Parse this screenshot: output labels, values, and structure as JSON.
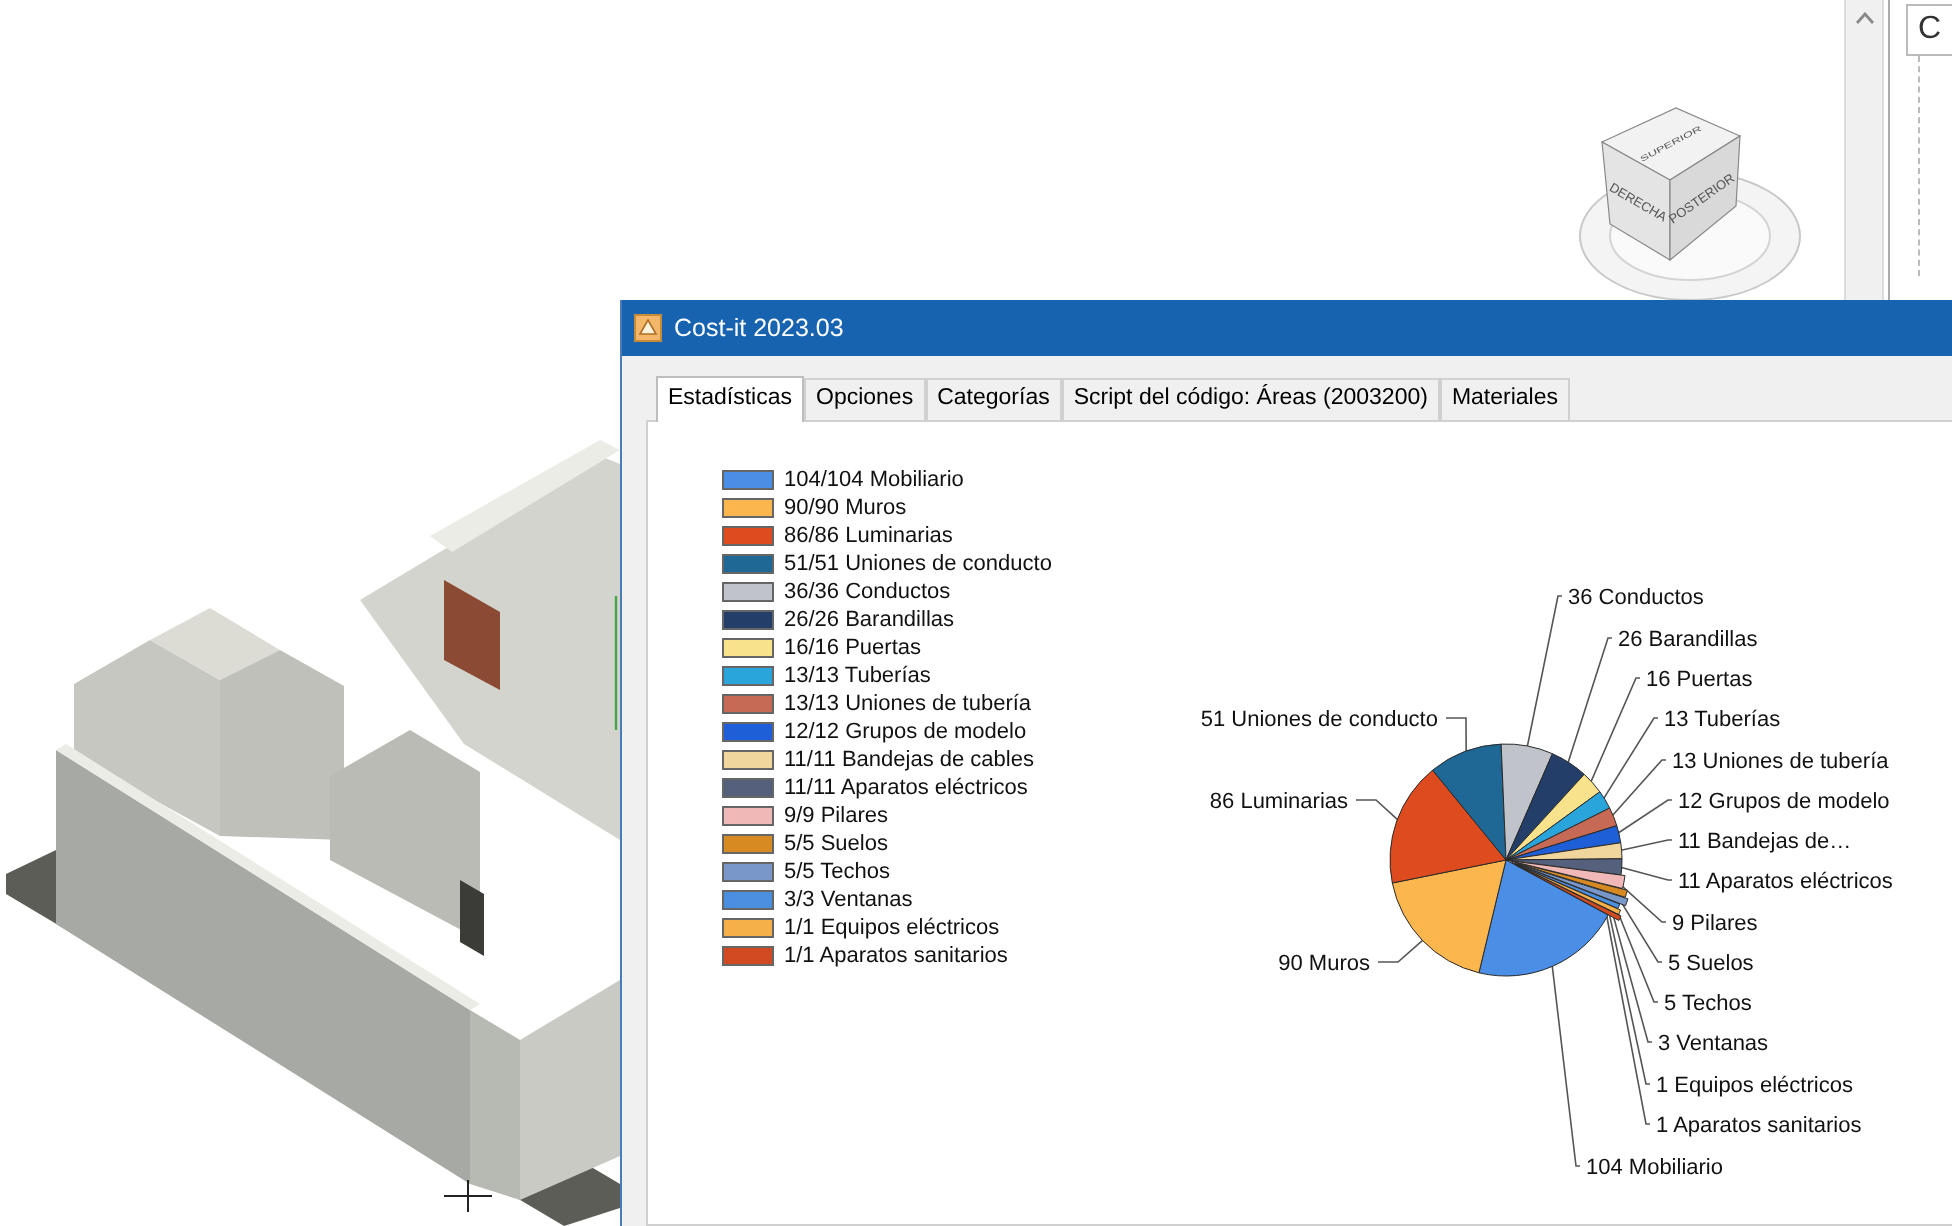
{
  "view_cube": {
    "faces": [
      "SUPERIOR",
      "DERECHA",
      "POSTERIOR"
    ]
  },
  "side_panel": {
    "field_text": "C"
  },
  "dialog": {
    "title": "Cost-it 2023.03",
    "tabs": [
      {
        "label": "Estadísticas",
        "selected": true
      },
      {
        "label": "Opciones",
        "selected": false
      },
      {
        "label": "Categorías",
        "selected": false
      },
      {
        "label": "Script del código: Áreas (2003200)",
        "selected": false
      },
      {
        "label": "Materiales",
        "selected": false
      }
    ],
    "legend": [
      {
        "label": "104/104 Mobiliario",
        "color": "#4a8ee6"
      },
      {
        "label": "90/90 Muros",
        "color": "#fbb64e"
      },
      {
        "label": "86/86 Luminarias",
        "color": "#de4b1e"
      },
      {
        "label": "51/51 Uniones de conducto",
        "color": "#1f6794"
      },
      {
        "label": "36/36 Conductos",
        "color": "#c0c3ca"
      },
      {
        "label": "26/26 Barandillas",
        "color": "#243e6a"
      },
      {
        "label": "16/16 Puertas",
        "color": "#f8e28c"
      },
      {
        "label": "13/13 Tuberías",
        "color": "#2aa5dc"
      },
      {
        "label": "13/13 Uniones de tubería",
        "color": "#c66a56"
      },
      {
        "label": "12/12 Grupos de modelo",
        "color": "#1e5ed6"
      },
      {
        "label": "11/11 Bandejas de cables",
        "color": "#f0d59c"
      },
      {
        "label": "11/11 Aparatos eléctricos",
        "color": "#55617c"
      },
      {
        "label": "9/9 Pilares",
        "color": "#f0b9b7"
      },
      {
        "label": "5/5 Suelos",
        "color": "#d88a22"
      },
      {
        "label": "5/5 Techos",
        "color": "#7997c8"
      },
      {
        "label": "3/3 Ventanas",
        "color": "#4b8fe0"
      },
      {
        "label": "1/1 Equipos eléctricos",
        "color": "#f6b04a"
      },
      {
        "label": "1/1 Aparatos sanitarios",
        "color": "#d14a22"
      }
    ],
    "chart_data": {
      "type": "pie",
      "values": [
        104,
        90,
        86,
        51,
        36,
        26,
        16,
        13,
        13,
        12,
        11,
        11,
        9,
        5,
        5,
        3,
        1,
        1
      ],
      "value_labels": [
        "104 Mobiliario",
        "90 Muros",
        "86 Luminarias",
        "51 Uniones de conducto",
        "36 Conductos",
        "26 Barandillas",
        "16 Puertas",
        "13 Tuberías",
        "13 Uniones de tubería",
        "12 Grupos de modelo",
        "11 Bandejas de…",
        "11 Aparatos eléctricos",
        "9 Pilares",
        "5 Suelos",
        "5 Techos",
        "3 Ventanas",
        "1 Equipos eléctricos",
        "1 Aparatos sanitarios"
      ]
    }
  }
}
